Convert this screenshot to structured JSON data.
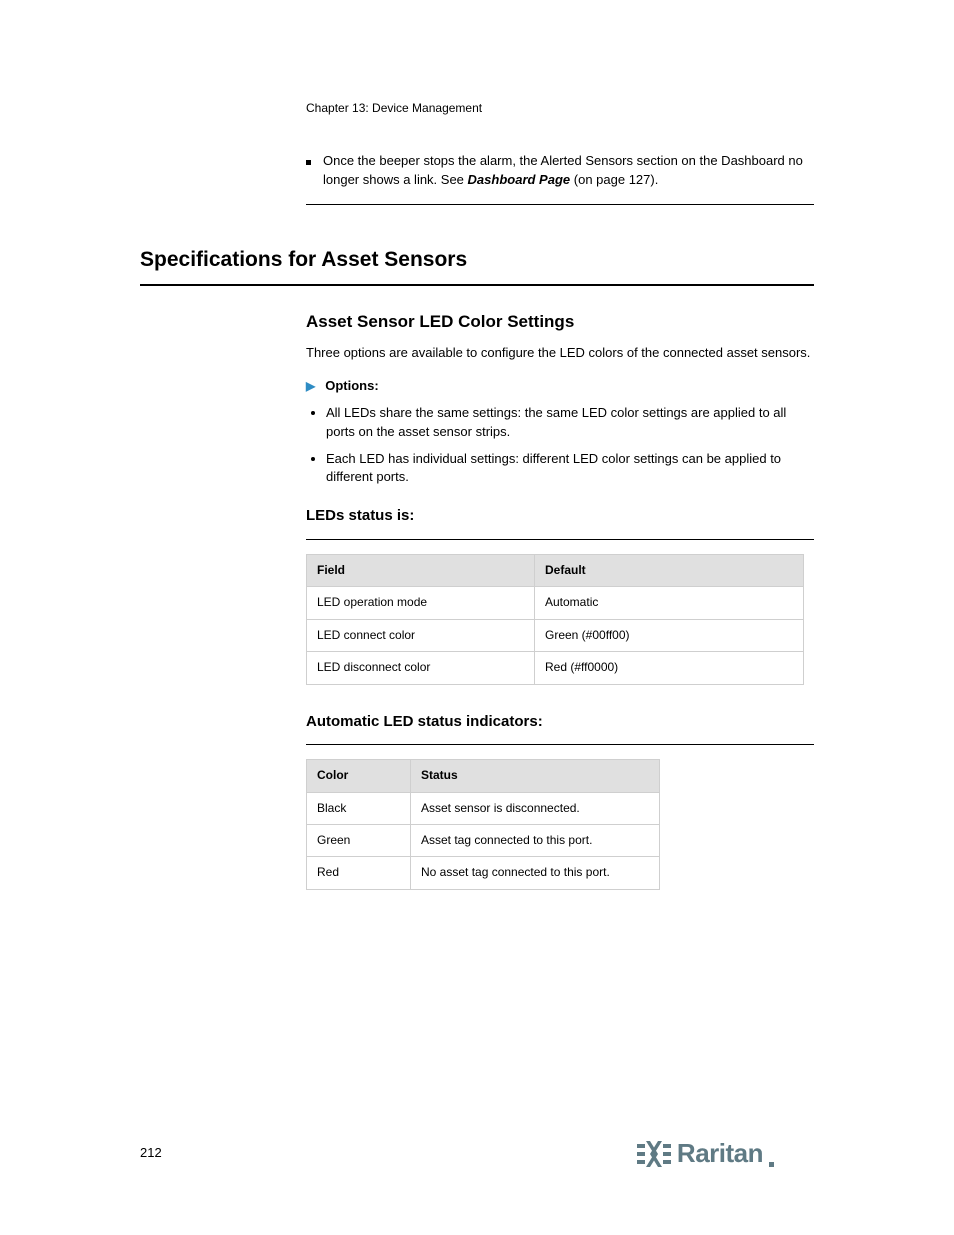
{
  "chapter_label": "Chapter 13: Device Management",
  "continuation": {
    "prefix": "Once the beeper stops the alarm, the Alerted Sensors section on the Dashboard no longer shows a link. See",
    "link_text": "Dashboard Page",
    "page_ref": "(on page 127)."
  },
  "section_heading": "Specifications for Asset Sensors",
  "subsection_heading": "Asset Sensor LED Color Settings",
  "lead_paragraph": "Three options are available to configure the LED colors of the connected asset sensors.",
  "options_heading": "Options:",
  "options": [
    "All LEDs share the same settings: the same LED color settings are applied to all ports on the asset sensor strips.",
    "Each LED has individual settings: different LED color settings can be applied to different ports."
  ],
  "tables": [
    {
      "title": "LEDs status is:",
      "columns": [
        "Field",
        "Default"
      ],
      "rows": [
        [
          "LED operation mode",
          "Automatic"
        ],
        [
          "LED connect color",
          "Green (#00ff00)"
        ],
        [
          "LED disconnect color",
          "Red (#ff0000)"
        ]
      ]
    },
    {
      "title": "Automatic LED status indicators:",
      "columns": [
        "Color",
        "Status"
      ],
      "rows": [
        [
          "Black",
          "Asset sensor is disconnected."
        ],
        [
          "Green",
          "Asset tag connected to this port."
        ],
        [
          "Red",
          "No asset tag connected to this port."
        ]
      ]
    }
  ],
  "page_number": "212",
  "logo_text": "Raritan"
}
